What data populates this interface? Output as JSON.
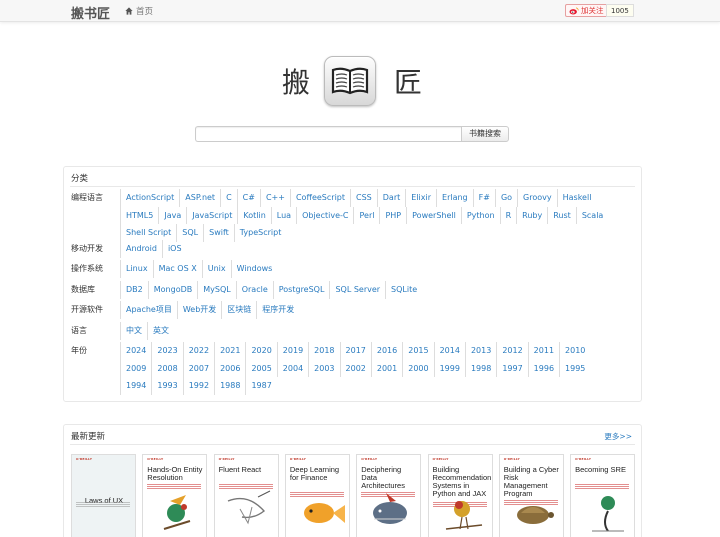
{
  "navbar": {
    "brand": "搬书匠",
    "home_label": "首页",
    "follow_label": "加关注",
    "follow_count": "1005"
  },
  "logo": {
    "left_char": "搬",
    "right_char": "匠"
  },
  "search": {
    "value": "",
    "placeholder": "",
    "button_label": "书籍搜索"
  },
  "categories": {
    "title": "分类",
    "rows": [
      {
        "label": "编程语言",
        "items": [
          "ActionScript",
          "ASP.net",
          "C",
          "C#",
          "C++",
          "CoffeeScript",
          "CSS",
          "Dart",
          "Elixir",
          "Erlang",
          "F#",
          "Go",
          "Groovy",
          "Haskell",
          "HTML5",
          "Java",
          "JavaScript",
          "Kotlin",
          "Lua",
          "Objective-C",
          "Perl",
          "PHP",
          "PowerShell",
          "Python",
          "R",
          "Ruby",
          "Rust",
          "Scala",
          "Shell Script",
          "SQL",
          "Swift",
          "TypeScript"
        ]
      },
      {
        "label": "移动开发",
        "items": [
          "Android",
          "iOS"
        ]
      },
      {
        "label": "操作系统",
        "items": [
          "Linux",
          "Mac OS X",
          "Unix",
          "Windows"
        ]
      },
      {
        "label": "数据库",
        "items": [
          "DB2",
          "MongoDB",
          "MySQL",
          "Oracle",
          "PostgreSQL",
          "SQL Server",
          "SQLite"
        ]
      },
      {
        "label": "开源软件",
        "items": [
          "Apache项目",
          "Web开发",
          "区块链",
          "程序开发"
        ]
      },
      {
        "label": "语言",
        "items": [
          "中文",
          "英文"
        ]
      },
      {
        "label": "年份",
        "items": [
          "2024",
          "2023",
          "2022",
          "2021",
          "2020",
          "2019",
          "2018",
          "2017",
          "2016",
          "2015",
          "2014",
          "2013",
          "2012",
          "2011",
          "2010",
          "2009",
          "2008",
          "2007",
          "2006",
          "2005",
          "2004",
          "2003",
          "2002",
          "2001",
          "2000",
          "1999",
          "1998",
          "1997",
          "1996",
          "1995",
          "1994",
          "1993",
          "1992",
          "1988",
          "1987"
        ]
      }
    ]
  },
  "latest": {
    "title": "最新更新",
    "more_label": "更多>>",
    "books": [
      {
        "title": "Laws of UX",
        "publisher": "O'REILLY"
      },
      {
        "title": "Hands-On Entity Resolution",
        "publisher": "O'REILLY"
      },
      {
        "title": "Fluent React",
        "publisher": "O'REILLY"
      },
      {
        "title": "Deep Learning for Finance",
        "publisher": "O'REILLY"
      },
      {
        "title": "Deciphering Data Architectures",
        "publisher": "O'REILLY"
      },
      {
        "title": "Building Recommendation Systems in Python and JAX",
        "publisher": "O'REILLY"
      },
      {
        "title": "Building a Cyber Risk Management Program",
        "publisher": "O'REILLY"
      },
      {
        "title": "Becoming SRE",
        "publisher": "O'REILLY"
      }
    ]
  }
}
